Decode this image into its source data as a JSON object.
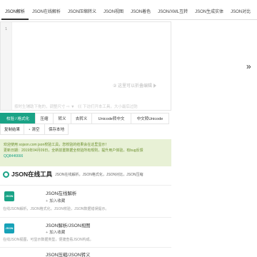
{
  "nav": {
    "tabs": [
      {
        "label": "JSON解析"
      },
      {
        "label": "JSON在线解析"
      },
      {
        "label": "JSON压缩转义"
      },
      {
        "label": "JSON视图"
      },
      {
        "label": "JSON着色"
      },
      {
        "label": "JSON/XML互转"
      },
      {
        "label": "JSON生成实体"
      },
      {
        "label": "JSON对比"
      }
    ],
    "active_index": 0
  },
  "editor": {
    "line_number": "1",
    "placeholder_mid": "② 这里可以折叠编辑",
    "placeholder_bottom": "按时生辅助下拖的，调整尺寸 ⇨ ▼ 《《 下访们开本工具，大小最后过防"
  },
  "expand_icon_glyph": "»",
  "buttons": [
    {
      "label": "校验 / 格式化",
      "primary": true
    },
    {
      "label": "压缩",
      "primary": false
    },
    {
      "label": "转义",
      "primary": false
    },
    {
      "label": "去转义",
      "primary": false
    },
    {
      "label": "Unicode转中文",
      "primary": false
    },
    {
      "label": "中文转Unicode",
      "primary": false
    },
    {
      "label": "复制结果",
      "primary": false
    },
    {
      "label": "清空",
      "primary": false
    },
    {
      "label": "保存本地",
      "primary": false
    }
  ],
  "notice": {
    "line1": "欢迎使用 sojson.com json校验工具，您校验的结果会在这里显示！",
    "line2": "更新日期：2019年04月09日，全新前置数据全校验所有规则，提升用户体验，有bug反馈",
    "line3": "QQ8446666"
  },
  "section": {
    "title": "JSON在线工具",
    "subtitle": "JSON在线解析，JSON格式化，JSON对比，JSON压缩"
  },
  "tools": [
    {
      "icon_text": "JSON",
      "name": "JSON在线解析",
      "fav_label": "加入收藏",
      "desc": "在线JSON解析，JSON格式化，JSON校验，JSON数据错误提示。"
    },
    {
      "icon_text": "JSON",
      "name": "JSON解析/JSON视图",
      "fav_label": "加入收藏",
      "desc": "在线JSON视图，可显示数据类型，便捷查看JSON构成。"
    },
    {
      "icon_text": "",
      "name": "JSON压缩/JSON转义",
      "fav_label": "",
      "desc": ""
    }
  ],
  "colors": {
    "accent": "#1aa386",
    "notice_bg": "#e8f1d6",
    "notice_text": "#6b8f2d"
  }
}
